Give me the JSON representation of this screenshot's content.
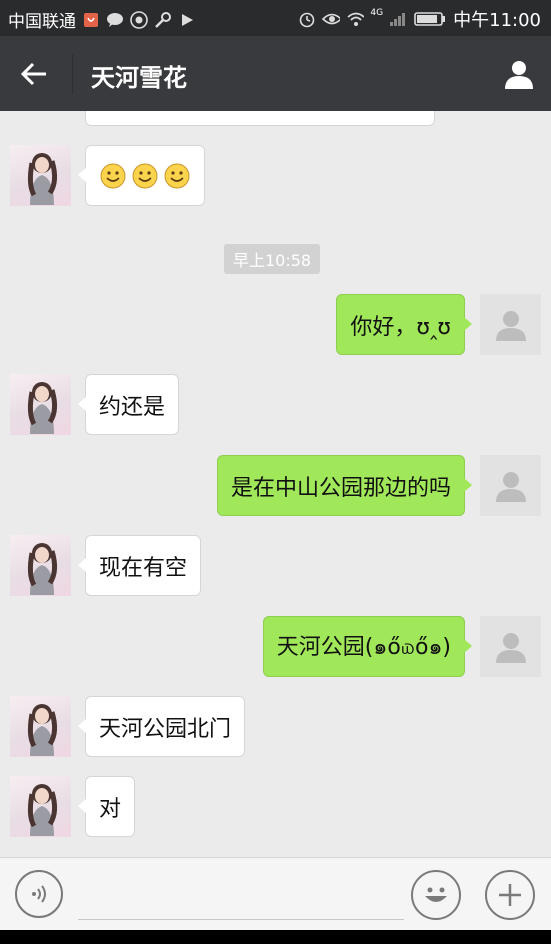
{
  "status_bar": {
    "carrier": "中国联通",
    "network": "4G",
    "time": "中午11:00"
  },
  "header": {
    "title": "天河雪花"
  },
  "messages": [
    {
      "from": "contact",
      "type": "emoji",
      "icon": "smile-emoji-icon",
      "count": 3
    },
    {
      "from": "system",
      "type": "timestamp",
      "text": "早上10:58"
    },
    {
      "from": "me",
      "type": "text",
      "text": "你好，ʊ‸ʊ"
    },
    {
      "from": "contact",
      "type": "text",
      "text": "约还是"
    },
    {
      "from": "me",
      "type": "text",
      "text": "是在中山公园那边的吗"
    },
    {
      "from": "contact",
      "type": "text",
      "text": "现在有空"
    },
    {
      "from": "me",
      "type": "text",
      "text": "天河公园(๑ő௰ő๑)"
    },
    {
      "from": "contact",
      "type": "text",
      "text": "天河公园北门"
    },
    {
      "from": "contact",
      "type": "text",
      "text": "对"
    }
  ],
  "input_bar": {
    "placeholder": "",
    "voice_icon": "voice-icon",
    "emoji_icon": "emoji-icon",
    "plus_icon": "plus-icon"
  },
  "colors": {
    "title_bar": "#393a3e",
    "status_bar": "#2a2b2d",
    "chat_bg": "#ebebeb",
    "outgoing_bubble": "#a0e75a",
    "incoming_bubble": "#ffffff"
  }
}
